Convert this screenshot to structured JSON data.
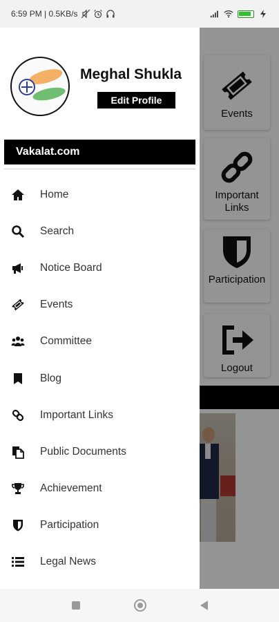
{
  "status_bar": {
    "time_text": "6:59 PM | 0.5KB/s",
    "icons": [
      "mute-icon",
      "alarm-icon",
      "headset-icon",
      "signal-icon",
      "wifi-icon",
      "battery-icon",
      "charging-icon"
    ]
  },
  "drawer": {
    "profile": {
      "name": "Meghal Shukla",
      "edit_label": "Edit Profile"
    },
    "site_label": "Vakalat.com",
    "menu": [
      {
        "label": "Home",
        "icon": "home-icon"
      },
      {
        "label": "Search",
        "icon": "search-icon"
      },
      {
        "label": "Notice Board",
        "icon": "megaphone-icon"
      },
      {
        "label": "Events",
        "icon": "ticket-icon"
      },
      {
        "label": "Committee",
        "icon": "users-icon"
      },
      {
        "label": "Blog",
        "icon": "bookmark-icon"
      },
      {
        "label": "Important Links",
        "icon": "link-icon"
      },
      {
        "label": "Public Documents",
        "icon": "documents-icon"
      },
      {
        "label": "Achievement",
        "icon": "trophy-icon"
      },
      {
        "label": "Participation",
        "icon": "shield-icon"
      },
      {
        "label": "Legal News",
        "icon": "list-icon"
      }
    ]
  },
  "background_app": {
    "tiles": [
      {
        "label": "Events",
        "icon": "ticket-icon"
      },
      {
        "label": "Important Links",
        "icon": "link-icon"
      },
      {
        "label": "Participation",
        "icon": "shield-icon"
      },
      {
        "label": "Logout",
        "icon": "logout-icon"
      }
    ]
  },
  "nav_bar": {
    "buttons": [
      "recents-button",
      "home-button",
      "back-button"
    ]
  },
  "colors": {
    "accent": "#000000",
    "drawer_bg": "#ffffff",
    "scrim": "rgba(0,0,0,0.42)"
  }
}
